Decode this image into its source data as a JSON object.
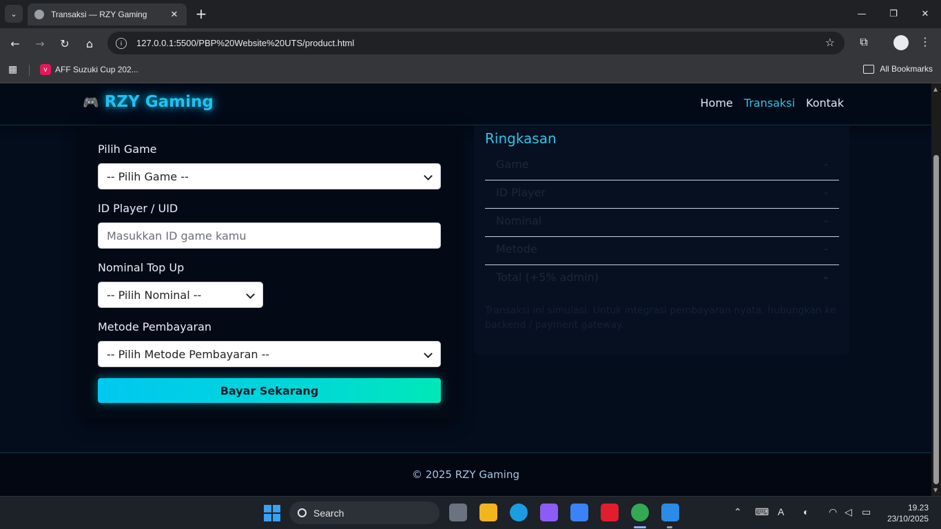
{
  "browser": {
    "tab_title": "Transaksi — RZY Gaming",
    "url": "127.0.0.1:5500/PBP%20Website%20UTS/product.html",
    "bookmark_item": "AFF Suzuki Cup 202...",
    "all_bookmarks": "All Bookmarks"
  },
  "site": {
    "brand": "RZY Gaming",
    "brand_icon": "🎮",
    "nav": [
      {
        "label": "Home",
        "active": false
      },
      {
        "label": "Transaksi",
        "active": true
      },
      {
        "label": "Kontak",
        "active": false
      }
    ]
  },
  "form": {
    "game_label": "Pilih Game",
    "game_value": "-- Pilih Game --",
    "id_label": "ID Player / UID",
    "id_placeholder": "Masukkan ID game kamu",
    "nominal_label": "Nominal Top Up",
    "nominal_value": "-- Pilih Nominal --",
    "method_label": "Metode Pembayaran",
    "method_value": "-- Pilih Metode Pembayaran --",
    "submit": "Bayar Sekarang"
  },
  "summary": {
    "title": "Ringkasan",
    "rows": [
      {
        "key": "Game",
        "value": "-"
      },
      {
        "key": "ID Player",
        "value": "-"
      },
      {
        "key": "Nominal",
        "value": "-"
      },
      {
        "key": "Metode",
        "value": "-"
      },
      {
        "key": "Total (+5% admin)",
        "value": "-"
      }
    ],
    "note": "Transaksi ini simulasi. Untuk integrasi pembayaran nyata, hubungkan ke backend / payment gateway."
  },
  "footer": {
    "copyright": "© 2025 RZY Gaming"
  },
  "taskbar": {
    "search_label": "Search",
    "time": "19.23",
    "date": "23/10/2025"
  },
  "colors": {
    "accent": "#27c6e8",
    "page_bg": "#040d1c",
    "button_gradient_start": "#00c8f0",
    "button_gradient_end": "#00e8b8"
  }
}
